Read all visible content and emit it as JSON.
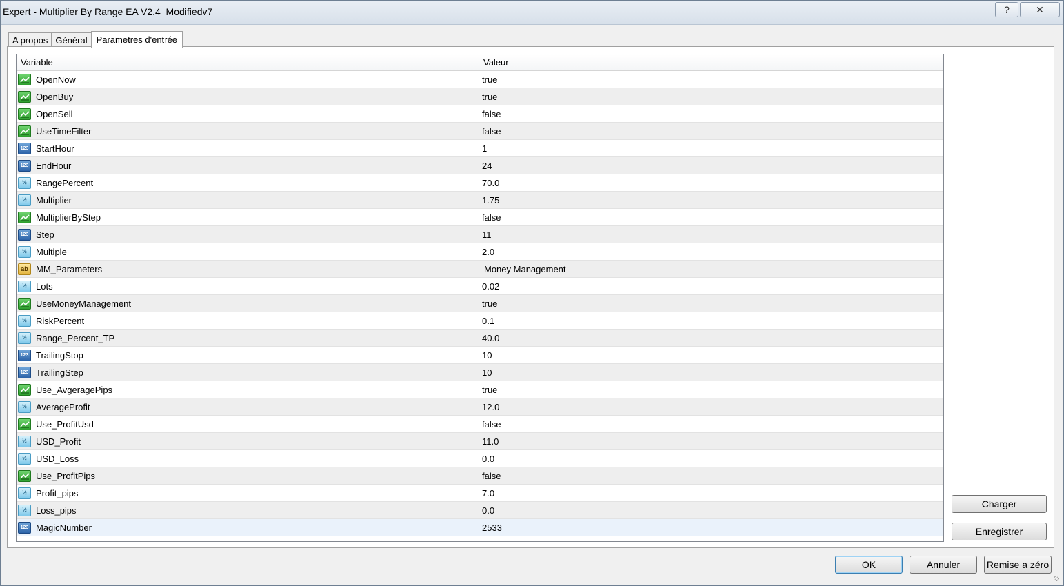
{
  "window": {
    "title": "Expert - Multiplier By Range EA V2.4_Modifiedv7",
    "help_label": "?",
    "close_label": "✕"
  },
  "tabs": [
    {
      "label": "A propos"
    },
    {
      "label": "Général"
    },
    {
      "label": "Parametres d'entrée",
      "active": true
    }
  ],
  "table": {
    "headers": {
      "variable": "Variable",
      "value": "Valeur"
    },
    "rows": [
      {
        "name": "OpenNow",
        "value": "true",
        "type": "bool"
      },
      {
        "name": "OpenBuy",
        "value": "true",
        "type": "bool"
      },
      {
        "name": "OpenSell",
        "value": "false",
        "type": "bool"
      },
      {
        "name": "UseTimeFilter",
        "value": "false",
        "type": "bool"
      },
      {
        "name": "StartHour",
        "value": "1",
        "type": "int"
      },
      {
        "name": "EndHour",
        "value": "24",
        "type": "int"
      },
      {
        "name": "RangePercent",
        "value": "70.0",
        "type": "double"
      },
      {
        "name": "Multiplier",
        "value": "1.75",
        "type": "double"
      },
      {
        "name": "MultiplierByStep",
        "value": "false",
        "type": "bool"
      },
      {
        "name": "Step",
        "value": "11",
        "type": "int"
      },
      {
        "name": "Multiple",
        "value": "2.0",
        "type": "double"
      },
      {
        "name": "MM_Parameters",
        "value": "Money Management",
        "type": "string"
      },
      {
        "name": "Lots",
        "value": "0.02",
        "type": "double"
      },
      {
        "name": "UseMoneyManagement",
        "value": "true",
        "type": "bool"
      },
      {
        "name": "RiskPercent",
        "value": "0.1",
        "type": "double"
      },
      {
        "name": "Range_Percent_TP",
        "value": "40.0",
        "type": "double"
      },
      {
        "name": "TrailingStop",
        "value": "10",
        "type": "int"
      },
      {
        "name": "TrailingStep",
        "value": "10",
        "type": "int"
      },
      {
        "name": "Use_AvgeragePips",
        "value": "true",
        "type": "bool"
      },
      {
        "name": "AverageProfit",
        "value": "12.0",
        "type": "double"
      },
      {
        "name": "Use_ProfitUsd",
        "value": "false",
        "type": "bool"
      },
      {
        "name": "USD_Profit",
        "value": "11.0",
        "type": "double"
      },
      {
        "name": "USD_Loss",
        "value": "0.0",
        "type": "double"
      },
      {
        "name": "Use_ProfitPips",
        "value": "false",
        "type": "bool"
      },
      {
        "name": "Profit_pips",
        "value": "7.0",
        "type": "double"
      },
      {
        "name": "Loss_pips",
        "value": "0.0",
        "type": "double"
      },
      {
        "name": "MagicNumber",
        "value": "2533",
        "type": "int",
        "selected": true
      }
    ]
  },
  "icons": {
    "bool": {
      "name": "boolean-type-icon",
      "glyph": ""
    },
    "int": {
      "name": "integer-type-icon",
      "glyph": "123"
    },
    "double": {
      "name": "double-type-icon",
      "glyph": "½"
    },
    "string": {
      "name": "string-type-icon",
      "glyph": "ab"
    }
  },
  "side_buttons": {
    "load": "Charger",
    "save": "Enregistrer"
  },
  "footer": {
    "ok": "OK",
    "cancel": "Annuler",
    "reset": "Remise a zéro"
  }
}
